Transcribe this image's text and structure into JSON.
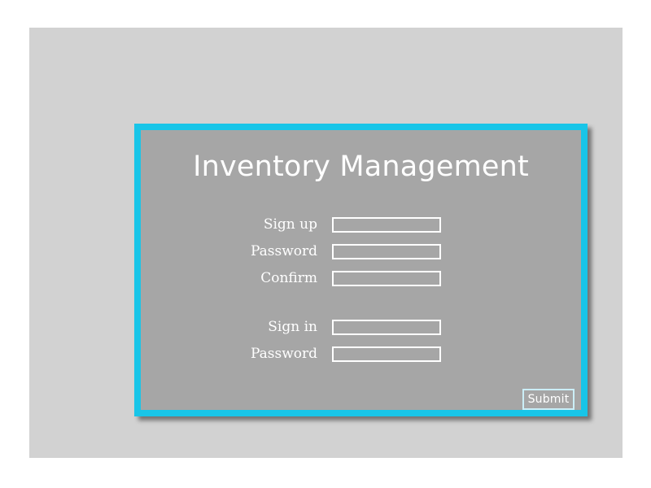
{
  "slide": {
    "background_color": "#d2d2d2"
  },
  "card": {
    "border_color": "#18c5e8",
    "background_color": "#a6a6a6",
    "title": "Inventory Management"
  },
  "form": {
    "signup_section": [
      {
        "label": "Sign up",
        "value": "",
        "placeholder": "",
        "name": "signup-username"
      },
      {
        "label": "Password",
        "value": "",
        "placeholder": "",
        "name": "signup-password"
      },
      {
        "label": "Confirm",
        "value": "",
        "placeholder": "",
        "name": "signup-confirm"
      }
    ],
    "signin_section": [
      {
        "label": "Sign in",
        "value": "",
        "placeholder": "",
        "name": "signin-username"
      },
      {
        "label": "Password",
        "value": "",
        "placeholder": "",
        "name": "signin-password"
      }
    ]
  },
  "actions": {
    "submit_label": "Submit"
  }
}
